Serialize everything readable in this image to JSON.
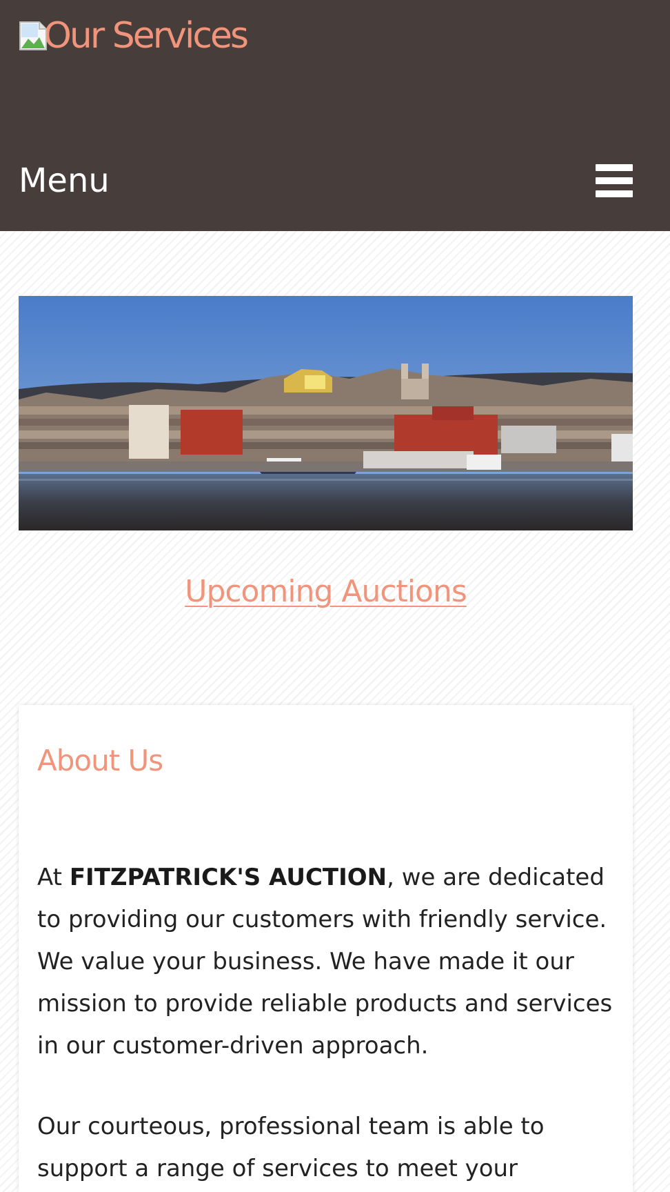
{
  "header": {
    "logo_text": "Our Services",
    "menu_label": "Menu"
  },
  "colors": {
    "header_bg": "#473d3b",
    "accent": "#f0947b",
    "text": "#222222"
  },
  "hero": {
    "description": "panoramic harbour image"
  },
  "links": {
    "upcoming_auctions": "Upcoming Auctions"
  },
  "about": {
    "title": "About Us",
    "intro_prefix": "At ",
    "company_name": "FITZPATRICK'S AUCTION",
    "intro_suffix": ", we are dedicated to providing our customers with friendly service. We value your business. We have made it our mission to provide reliable products and services in our customer-driven approach.",
    "paragraph2": "Our courteous, professional team is able to support a range of services to meet your"
  },
  "icons": [
    "broken-image-icon",
    "hamburger-menu-icon"
  ]
}
